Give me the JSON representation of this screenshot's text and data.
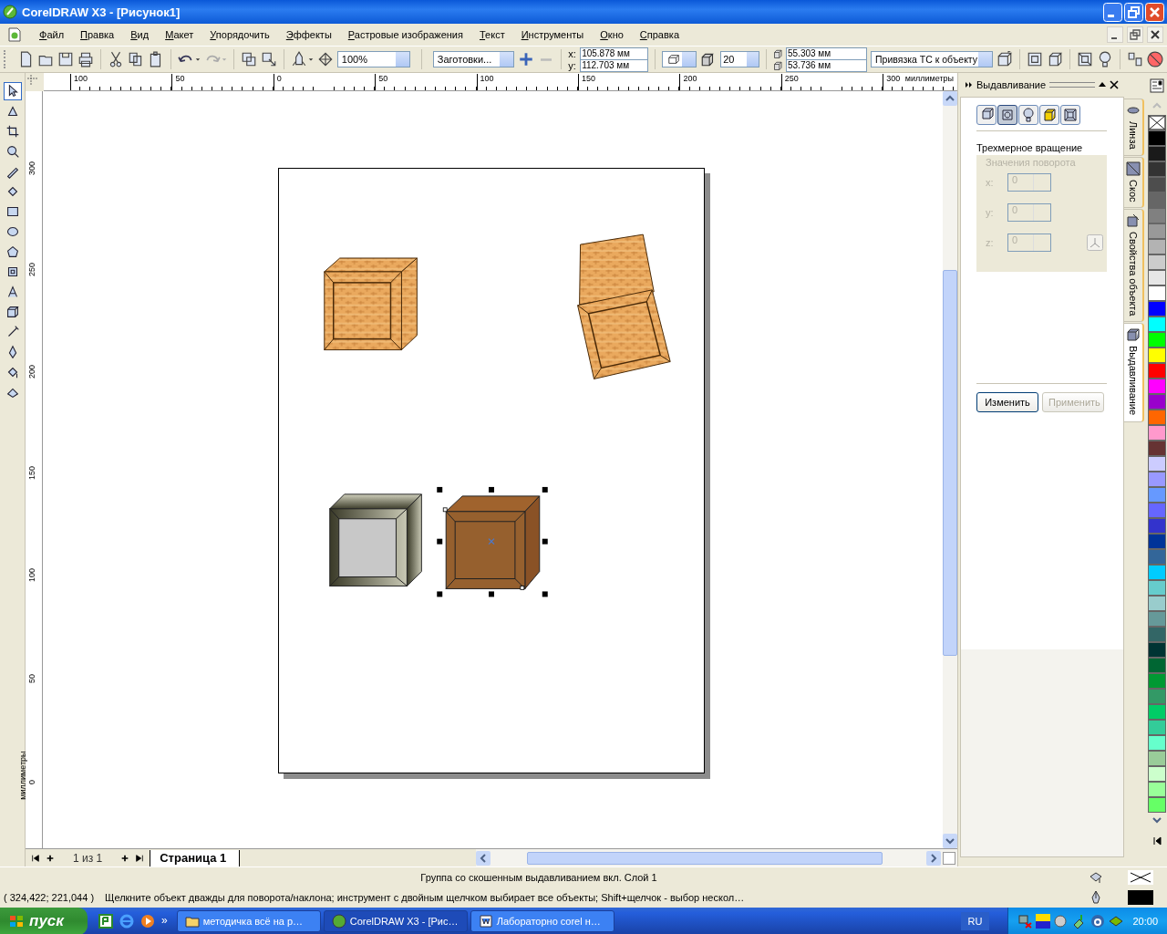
{
  "window": {
    "title": "CorelDRAW X3 - [Рисунок1]"
  },
  "menu": [
    "Файл",
    "Правка",
    "Вид",
    "Макет",
    "Упорядочить",
    "Эффекты",
    "Растровые изображения",
    "Текст",
    "Инструменты",
    "Окно",
    "Справка"
  ],
  "toolbar": {
    "zoom": "100%",
    "presets": "Заготовки...",
    "position": [
      {
        "label": "x:",
        "value": "105.878 мм"
      },
      {
        "label": "y:",
        "value": "112.703 мм"
      }
    ],
    "depth": "20",
    "vanishing": [
      "55.303 мм",
      "53.736 мм"
    ],
    "vanishing_lock": "Привязка ТС к объекту"
  },
  "toolbox": [
    {
      "kind": "pick",
      "selected": true
    },
    {
      "kind": "shape",
      "selected": false
    },
    {
      "kind": "crop",
      "selected": false
    },
    {
      "kind": "zoom",
      "selected": false
    },
    {
      "kind": "freehand",
      "selected": false
    },
    {
      "kind": "smartfill",
      "selected": false
    },
    {
      "kind": "rectangle",
      "selected": false
    },
    {
      "kind": "ellipse",
      "selected": false
    },
    {
      "kind": "polygon",
      "selected": false
    },
    {
      "kind": "basicshapes",
      "selected": false
    },
    {
      "kind": "text",
      "selected": false
    },
    {
      "kind": "interactive",
      "selected": false
    },
    {
      "kind": "eyedropper",
      "selected": false
    },
    {
      "kind": "outline",
      "selected": false
    },
    {
      "kind": "fill",
      "selected": false
    },
    {
      "kind": "interactivefill",
      "selected": false
    }
  ],
  "rulers": {
    "horizontal": [
      "100",
      "50",
      "0",
      "50",
      "100",
      "150",
      "200",
      "250",
      "300"
    ],
    "horizontal_unit": "миллиметры",
    "vertical": [
      "300",
      "250",
      "200",
      "150",
      "100",
      "50",
      "0"
    ],
    "vertical_unit": "миллиметры"
  },
  "pages": {
    "counter": "1 из 1",
    "tabs": [
      {
        "label": "Страница 1",
        "selected": true
      }
    ]
  },
  "docker": {
    "title": "Выдавливание",
    "modes": [
      {
        "kind": "extrude",
        "selected": false
      },
      {
        "kind": "rotate",
        "selected": true
      },
      {
        "kind": "lighting",
        "selected": false
      },
      {
        "kind": "color",
        "selected": false
      },
      {
        "kind": "bevel",
        "selected": false
      }
    ],
    "section": "Трехмерное вращение",
    "group": "Значения поворота",
    "disabled": true,
    "fields": [
      {
        "label": "x:",
        "value": "0"
      },
      {
        "label": "y:",
        "value": "0"
      },
      {
        "label": "z:",
        "value": "0"
      }
    ],
    "buttons": [
      {
        "label": "Изменить",
        "disabled": false
      },
      {
        "label": "Применить",
        "disabled": true
      }
    ]
  },
  "docker_tabs": [
    {
      "label": "Линза",
      "kind": "lens",
      "selected": false
    },
    {
      "label": "Скос",
      "kind": "bevel",
      "selected": false
    },
    {
      "label": "Свойства объекта",
      "kind": "properties",
      "selected": false
    },
    {
      "label": "Выдавливание",
      "kind": "extrude",
      "selected": true
    }
  ],
  "palette": [
    {
      "kind": "none"
    },
    {
      "kind": "color",
      "color": "#000000"
    },
    {
      "kind": "color",
      "color": "#1a1a1a"
    },
    {
      "kind": "color",
      "color": "#333333"
    },
    {
      "kind": "color",
      "color": "#4d4d4d"
    },
    {
      "kind": "color",
      "color": "#666666"
    },
    {
      "kind": "color",
      "color": "#808080"
    },
    {
      "kind": "color",
      "color": "#999999"
    },
    {
      "kind": "color",
      "color": "#b3b3b3"
    },
    {
      "kind": "color",
      "color": "#cccccc"
    },
    {
      "kind": "color",
      "color": "#e6e6e6"
    },
    {
      "kind": "color",
      "color": "#ffffff"
    },
    {
      "kind": "color",
      "color": "#0000ff"
    },
    {
      "kind": "color",
      "color": "#00ffff"
    },
    {
      "kind": "color",
      "color": "#00ff00"
    },
    {
      "kind": "color",
      "color": "#ffff00"
    },
    {
      "kind": "color",
      "color": "#ff0000"
    },
    {
      "kind": "color",
      "color": "#ff00ff"
    },
    {
      "kind": "color",
      "color": "#9900cc"
    },
    {
      "kind": "color",
      "color": "#ff6600"
    },
    {
      "kind": "color",
      "color": "#ff99cc"
    },
    {
      "kind": "color",
      "color": "#663333"
    },
    {
      "kind": "color",
      "color": "#ccccff"
    },
    {
      "kind": "color",
      "color": "#9999ff"
    },
    {
      "kind": "color",
      "color": "#6699ff"
    },
    {
      "kind": "color",
      "color": "#6666ff"
    },
    {
      "kind": "color",
      "color": "#3333cc"
    },
    {
      "kind": "color",
      "color": "#003399"
    },
    {
      "kind": "color",
      "color": "#336699"
    },
    {
      "kind": "color",
      "color": "#00ccff"
    },
    {
      "kind": "color",
      "color": "#66cccc"
    },
    {
      "kind": "color",
      "color": "#99cccc"
    },
    {
      "kind": "color",
      "color": "#669999"
    },
    {
      "kind": "color",
      "color": "#336666"
    },
    {
      "kind": "color",
      "color": "#003333"
    },
    {
      "kind": "color",
      "color": "#006633"
    },
    {
      "kind": "color",
      "color": "#009933"
    },
    {
      "kind": "color",
      "color": "#339966"
    },
    {
      "kind": "color",
      "color": "#00cc66"
    },
    {
      "kind": "color",
      "color": "#33cc99"
    },
    {
      "kind": "color",
      "color": "#66ffcc"
    },
    {
      "kind": "color",
      "color": "#99cc99"
    },
    {
      "kind": "color",
      "color": "#ccffcc"
    },
    {
      "kind": "color",
      "color": "#99ff99"
    },
    {
      "kind": "color",
      "color": "#66ff66"
    }
  ],
  "status": {
    "object": "Группа со скошенным выдавливанием вкл. Слой 1",
    "coordinates": "( 324,422; 221,044 )",
    "hint": "Щелкните объект дважды для поворота/наклона; инструмент с двойным щелчком выбирает все объекты; Shift+щелчок - выбор нескол…"
  },
  "taskbar": {
    "start": "пуск",
    "quick_launch_more": "»",
    "tasks": [
      {
        "label": "методичка всё на р…",
        "kind": "folder",
        "selected": false
      },
      {
        "label": "CorelDRAW X3 - [Рис…",
        "kind": "corel",
        "selected": true
      },
      {
        "label": "Лабораторно corel н…",
        "kind": "word",
        "selected": false
      }
    ],
    "language": "RU",
    "clock": "20:00"
  }
}
